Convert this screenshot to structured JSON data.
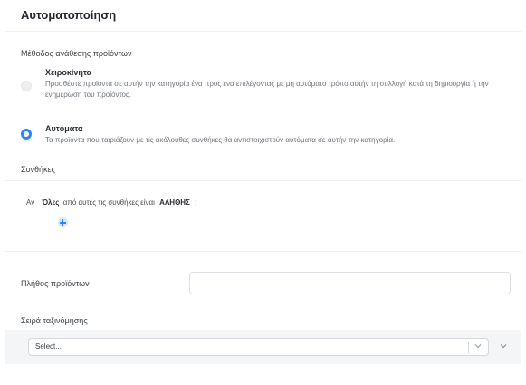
{
  "page": {
    "title": "Αυτοματοποίηση"
  },
  "assignment": {
    "label": "Μέθοδος ανάθεσης προϊόντων",
    "options": [
      {
        "title": "Χειροκίνητα",
        "description": "Προσθέστε προϊόντα σε αυτήν την κατηγορία ένα προς ένα επιλέγοντας με μη αυτόματο τρόπο αυτήν τη συλλογή κατά τη δημιουργία ή την ενημέρωση του προϊόντος.",
        "selected": false
      },
      {
        "title": "Αυτόματα",
        "description": "Τα προϊόντα που ταιριάζουν με τις ακόλουθες συνθήκες θα αντιστοιχιστούν αυτόματα σε αυτήν την κατηγορία.",
        "selected": true
      }
    ]
  },
  "conditions": {
    "label": "Συνθήκες",
    "if_text": "Αν",
    "all_value": "Όλες",
    "middle_text": "από αυτές τις συνθήκες είναι",
    "true_value": "ΑΛΗΘΗΣ",
    "colon": ":",
    "add_icon": "plus-circle-icon"
  },
  "product_count": {
    "label": "Πλήθος προϊόντων",
    "value": "",
    "placeholder": ""
  },
  "sort_order": {
    "label": "Σειρά ταξινόμησης",
    "placeholder": "Select..."
  },
  "colors": {
    "accent": "#2a86f5",
    "panel_bg": "#f4f5f7"
  }
}
